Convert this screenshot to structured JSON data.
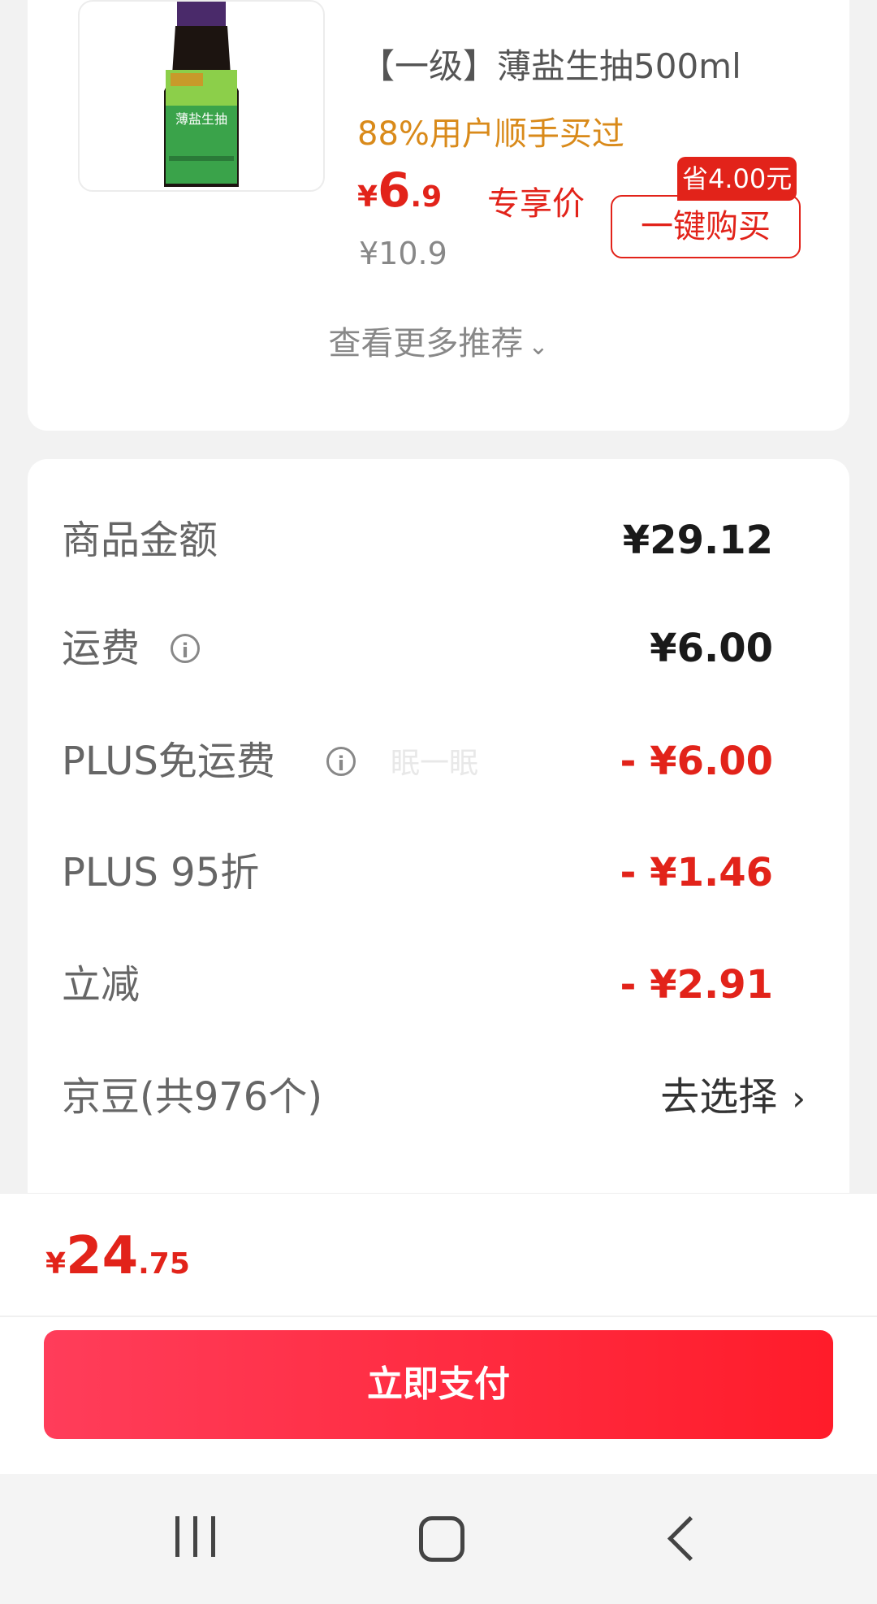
{
  "recommendation": {
    "name": "【一级】薄盐生抽500ml",
    "bought_text": "88%用户顺手买过",
    "price_currency": "¥",
    "price_int": "6",
    "price_dec": ".9",
    "price_tag": "专享价",
    "original_price": "¥10.9",
    "save_badge": "省4.00元",
    "buy_button": "一键购买",
    "more_text": "查看更多推荐",
    "more_icon": "chevron-down-icon",
    "bottle_label": "薄盐生抽"
  },
  "summary": {
    "rows": [
      {
        "label": "商品金额",
        "value": "¥29.12"
      },
      {
        "label": "运费",
        "value": "¥6.00"
      },
      {
        "label": "PLUS免运费",
        "value": "- ¥6.00"
      },
      {
        "label": "PLUS 95折",
        "value": "- ¥1.46"
      },
      {
        "label": "立减",
        "value": "- ¥2.91"
      },
      {
        "label": "京豆(共976个)",
        "value": "去选择"
      }
    ],
    "watermark": "眠一眠"
  },
  "payment": {
    "total_currency": "¥",
    "total_int": "24",
    "total_dec": ".75",
    "pay_button": "立即支付"
  },
  "colors": {
    "accent_red": "#e2231a",
    "pay_gradient_start": "#ff3d5a",
    "pay_gradient_end": "#ff1c2a",
    "bought_orange": "#d98a1a"
  }
}
